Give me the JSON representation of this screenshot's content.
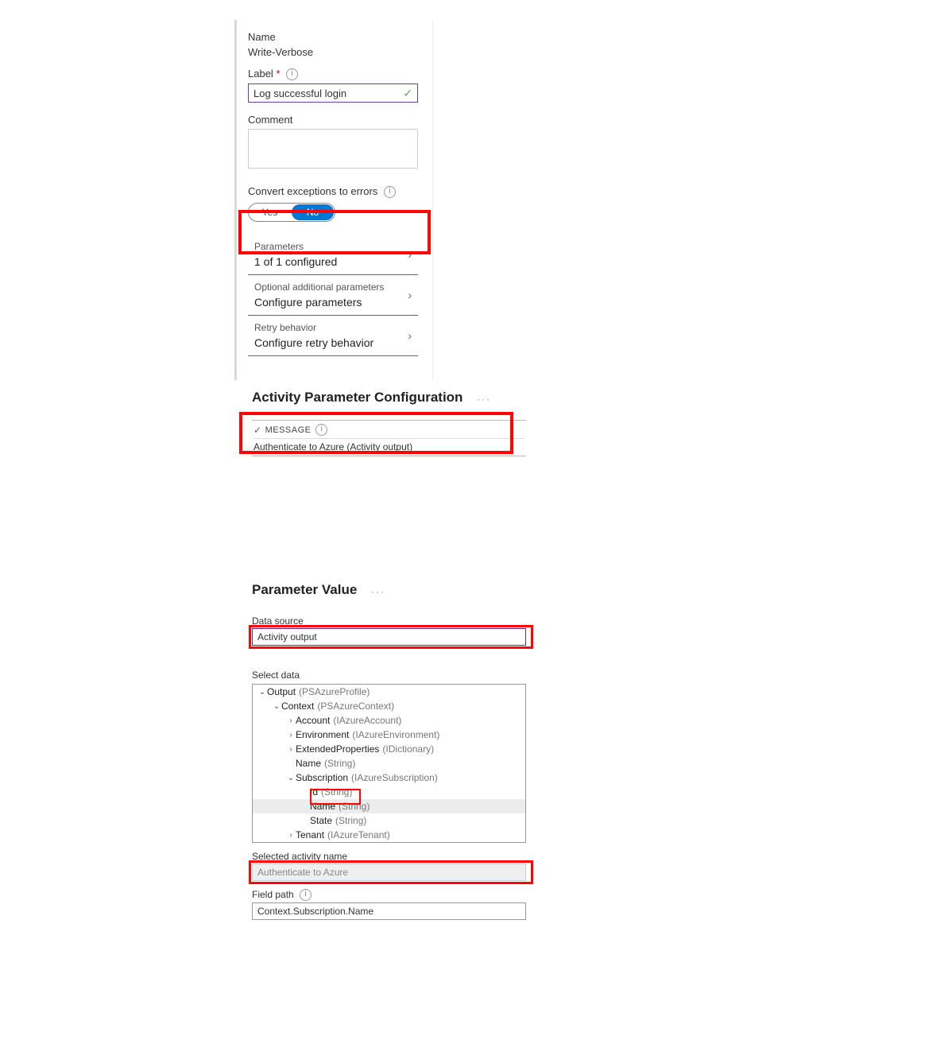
{
  "panel1": {
    "name_label": "Name",
    "name_value": "Write-Verbose",
    "label_label": "Label",
    "label_required": "*",
    "label_value": "Log successful login",
    "comment_label": "Comment",
    "comment_value": "",
    "convert_label": "Convert exceptions to errors",
    "toggle_yes": "Yes",
    "toggle_no": "No",
    "items": [
      {
        "label": "Parameters",
        "value": "1 of 1 configured"
      },
      {
        "label": "Optional additional parameters",
        "value": "Configure parameters"
      },
      {
        "label": "Retry behavior",
        "value": "Configure retry behavior"
      }
    ]
  },
  "panel2": {
    "title": "Activity Parameter Configuration",
    "message_header": "MESSAGE",
    "message_value": "Authenticate to Azure (Activity output)"
  },
  "panel3": {
    "title": "Parameter Value",
    "data_source_label": "Data source",
    "data_source_value": "Activity output",
    "select_data_label": "Select data",
    "tree": [
      {
        "indent": 0,
        "exp": "open",
        "name": "Output",
        "type": "(PSAzureProfile)"
      },
      {
        "indent": 1,
        "exp": "open",
        "name": "Context",
        "type": "(PSAzureContext)"
      },
      {
        "indent": 2,
        "exp": "closed",
        "name": "Account",
        "type": "(IAzureAccount)"
      },
      {
        "indent": 2,
        "exp": "closed",
        "name": "Environment",
        "type": "(IAzureEnvironment)"
      },
      {
        "indent": 2,
        "exp": "closed",
        "name": "ExtendedProperties",
        "type": "(IDictionary)"
      },
      {
        "indent": 2,
        "exp": "none",
        "name": "Name",
        "type": "(String)"
      },
      {
        "indent": 2,
        "exp": "open",
        "name": "Subscription",
        "type": "(IAzureSubscription)"
      },
      {
        "indent": 3,
        "exp": "none",
        "name": "Id",
        "type": "(String)"
      },
      {
        "indent": 3,
        "exp": "none",
        "name": "Name",
        "type": "(String)",
        "selected": true
      },
      {
        "indent": 3,
        "exp": "none",
        "name": "State",
        "type": "(String)"
      },
      {
        "indent": 2,
        "exp": "closed",
        "name": "Tenant",
        "type": "(IAzureTenant)"
      }
    ],
    "selected_activity_label": "Selected activity name",
    "selected_activity_value": "Authenticate to Azure",
    "field_path_label": "Field path",
    "field_path_value": "Context.Subscription.Name"
  }
}
